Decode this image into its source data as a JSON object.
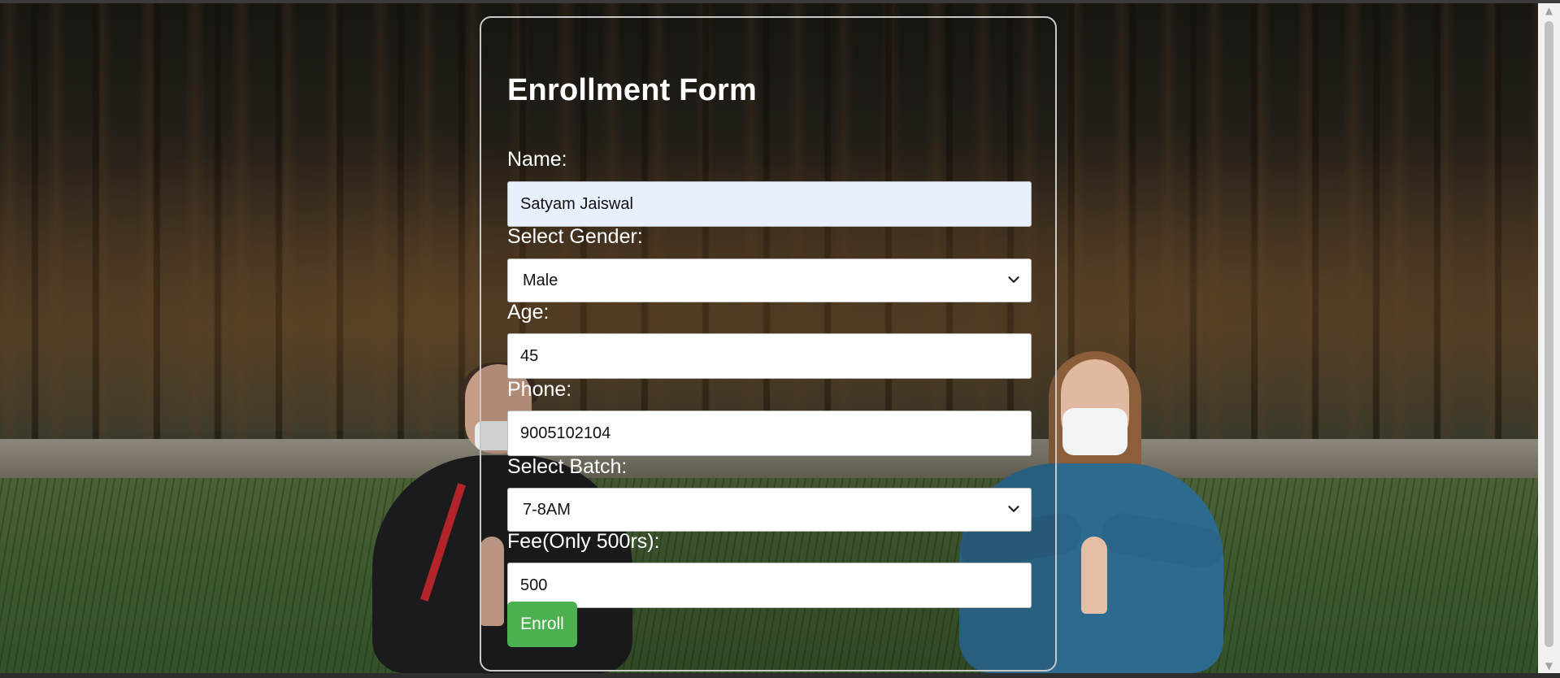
{
  "form": {
    "title": "Enrollment Form",
    "name_label": "Name:",
    "name_value": "Satyam Jaiswal",
    "gender_label": "Select Gender:",
    "gender_value": "Male",
    "age_label": "Age:",
    "age_value": "45",
    "phone_label": "Phone:",
    "phone_value": "9005102104",
    "batch_label": "Select Batch:",
    "batch_value": "7-8AM",
    "fee_label": "Fee(Only 500rs):",
    "fee_value": "500",
    "submit_label": "Enroll"
  },
  "colors": {
    "submit_button": "#4caf50",
    "autofill_field": "#e8f0fe",
    "card_border": "#c9c9c9"
  },
  "icons": {
    "select_chevron": "chevron-down-icon",
    "scroll_up": "scroll-up-arrow",
    "scroll_down": "scroll-down-arrow"
  }
}
